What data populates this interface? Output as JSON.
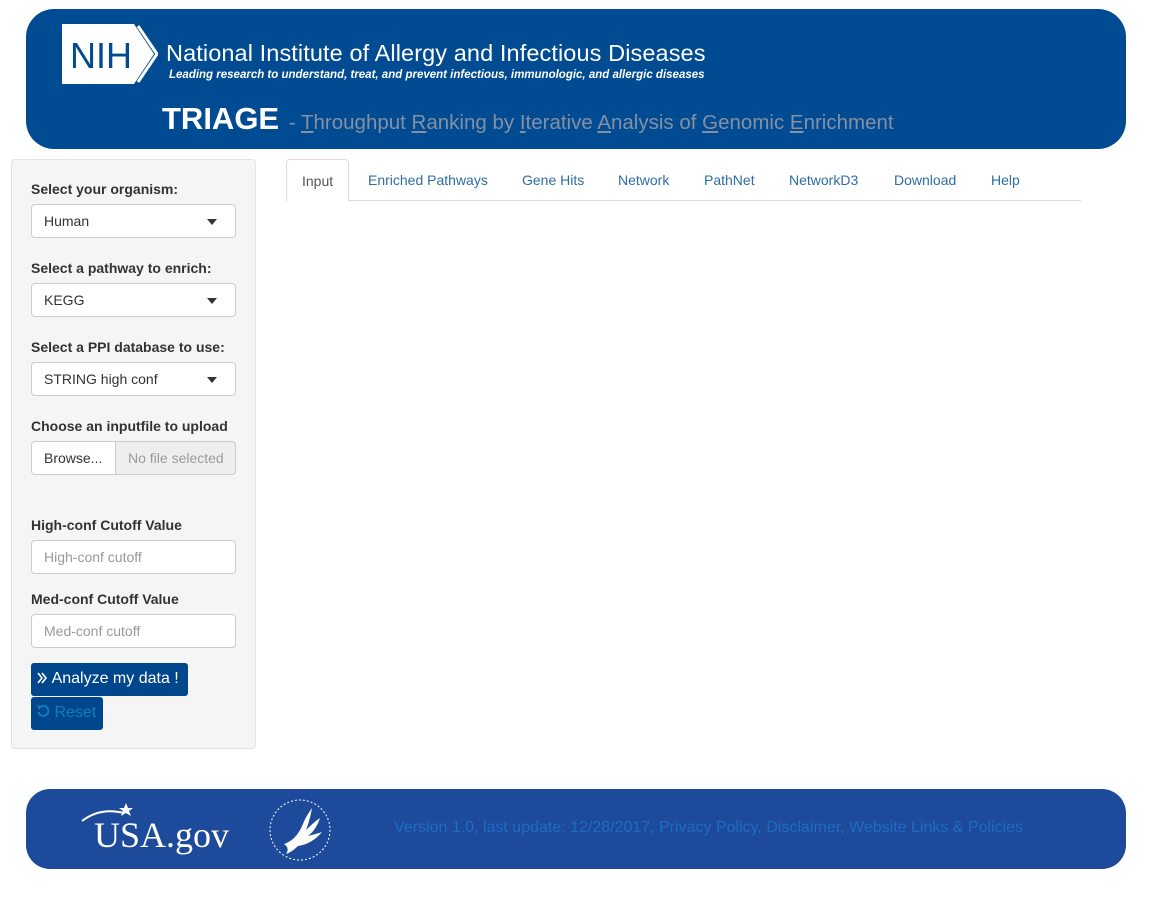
{
  "header": {
    "logo_text": "NIH",
    "institute_name": "National Institute of Allergy and Infectious Diseases",
    "tagline": "Leading research to understand, treat, and prevent infectious, immunologic, and allergic diseases",
    "app_title": "TRIAGE",
    "subtitle_parts": [
      {
        "text": " - ",
        "initial": false
      },
      {
        "text": "T",
        "initial": true
      },
      {
        "text": "hroughput ",
        "initial": false
      },
      {
        "text": "R",
        "initial": true
      },
      {
        "text": "anking by ",
        "initial": false
      },
      {
        "text": "I",
        "initial": true
      },
      {
        "text": "terative ",
        "initial": false
      },
      {
        "text": "A",
        "initial": true
      },
      {
        "text": "nalysis of ",
        "initial": false
      },
      {
        "text": "G",
        "initial": true
      },
      {
        "text": "enomic ",
        "initial": false
      },
      {
        "text": "E",
        "initial": true
      },
      {
        "text": "nrichment",
        "initial": false
      }
    ]
  },
  "sidebar": {
    "organism": {
      "label": "Select your organism:",
      "value": "Human"
    },
    "pathway": {
      "label": "Select a pathway to enrich:",
      "value": "KEGG"
    },
    "ppi": {
      "label": "Select a PPI database to use:",
      "value": "STRING high conf"
    },
    "file": {
      "label": "Choose an inputfile to upload",
      "browse_label": "Browse...",
      "status": "No file selected"
    },
    "high_cutoff": {
      "label": "High-conf Cutoff Value",
      "placeholder": "High-conf cutoff"
    },
    "med_cutoff": {
      "label": "Med-conf Cutoff Value",
      "placeholder": "Med-conf cutoff"
    },
    "analyze_label": "Analyze my data !",
    "reset_label": "Reset"
  },
  "tabs": [
    {
      "label": "Input",
      "active": true
    },
    {
      "label": "Enriched Pathways",
      "active": false
    },
    {
      "label": "Gene Hits",
      "active": false
    },
    {
      "label": "Network",
      "active": false
    },
    {
      "label": "PathNet",
      "active": false
    },
    {
      "label": "NetworkD3",
      "active": false
    },
    {
      "label": "Download",
      "active": false
    },
    {
      "label": "Help",
      "active": false
    }
  ],
  "footer": {
    "usa_logo_text": "USA.gov",
    "text": "Version 1.0, last update: 12/28/2017, Privacy Policy, Disclaimer, Website Links & Policies"
  },
  "colors": {
    "header_bg": "#004b91",
    "footer_bg": "#1d4a9b",
    "button_bg": "#00468c",
    "tab_link": "#2e6da4",
    "subtitle_gray": "#8590a3"
  },
  "icons": [
    "double-chevron-right-icon",
    "reset-icon",
    "caret-down-icon",
    "hhs-eagle-logo",
    "usa-star-icon"
  ]
}
